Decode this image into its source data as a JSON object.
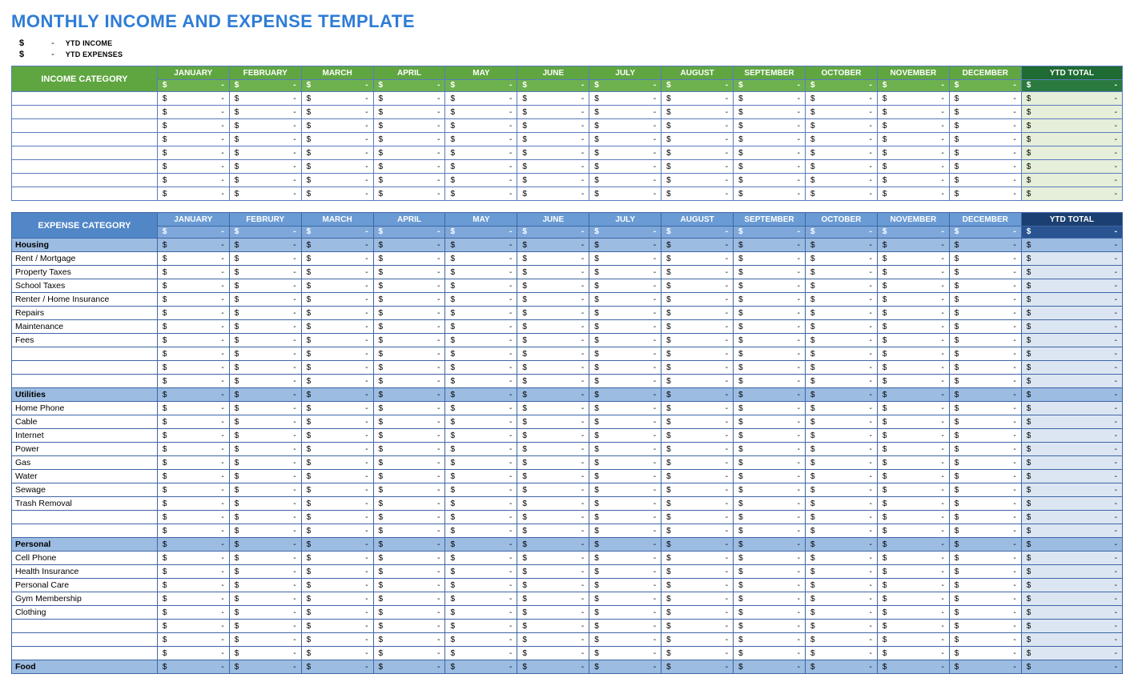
{
  "title": "MONTHLY INCOME AND EXPENSE TEMPLATE",
  "summary": {
    "ytd_income_symbol": "$",
    "ytd_income_dash": "-",
    "ytd_income_label": "YTD INCOME",
    "ytd_expenses_symbol": "$",
    "ytd_expenses_dash": "-",
    "ytd_expenses_label": "YTD EXPENSES"
  },
  "months_income": [
    "JANUARY",
    "FEBRUARY",
    "MARCH",
    "APRIL",
    "MAY",
    "JUNE",
    "JULY",
    "AUGUST",
    "SEPTEMBER",
    "OCTOBER",
    "NOVEMBER",
    "DECEMBER"
  ],
  "months_expense": [
    "JANUARY",
    "FEBRURY",
    "MARCH",
    "APRIL",
    "MAY",
    "JUNE",
    "JULY",
    "AUGUST",
    "SEPTEMBER",
    "OCTOBER",
    "NOVEMBER",
    "DECEMBER"
  ],
  "ytd_total_label": "YTD TOTAL",
  "income_category_label": "INCOME CATEGORY",
  "expense_category_label": "EXPENSE CATEGORY",
  "money_placeholder": {
    "symbol": "$",
    "value": "-"
  },
  "income_rows": [
    {
      "label": ""
    },
    {
      "label": ""
    },
    {
      "label": ""
    },
    {
      "label": ""
    },
    {
      "label": ""
    },
    {
      "label": ""
    },
    {
      "label": ""
    },
    {
      "label": ""
    }
  ],
  "expense_rows": [
    {
      "type": "section",
      "label": "Housing"
    },
    {
      "type": "item",
      "label": "Rent / Mortgage"
    },
    {
      "type": "item",
      "label": "Property Taxes"
    },
    {
      "type": "item",
      "label": "School Taxes"
    },
    {
      "type": "item",
      "label": "Renter / Home Insurance"
    },
    {
      "type": "item",
      "label": "Repairs"
    },
    {
      "type": "item",
      "label": "Maintenance"
    },
    {
      "type": "item",
      "label": "Fees"
    },
    {
      "type": "item",
      "label": ""
    },
    {
      "type": "item",
      "label": ""
    },
    {
      "type": "item",
      "label": ""
    },
    {
      "type": "section",
      "label": "Utilities"
    },
    {
      "type": "item",
      "label": "Home Phone"
    },
    {
      "type": "item",
      "label": "Cable"
    },
    {
      "type": "item",
      "label": "Internet"
    },
    {
      "type": "item",
      "label": "Power"
    },
    {
      "type": "item",
      "label": "Gas"
    },
    {
      "type": "item",
      "label": "Water"
    },
    {
      "type": "item",
      "label": "Sewage"
    },
    {
      "type": "item",
      "label": "Trash Removal"
    },
    {
      "type": "item",
      "label": ""
    },
    {
      "type": "item",
      "label": ""
    },
    {
      "type": "section",
      "label": "Personal"
    },
    {
      "type": "item",
      "label": "Cell Phone"
    },
    {
      "type": "item",
      "label": "Health Insurance"
    },
    {
      "type": "item",
      "label": "Personal Care"
    },
    {
      "type": "item",
      "label": "Gym Membership"
    },
    {
      "type": "item",
      "label": "Clothing"
    },
    {
      "type": "item",
      "label": ""
    },
    {
      "type": "item",
      "label": ""
    },
    {
      "type": "item",
      "label": ""
    },
    {
      "type": "section",
      "label": "Food"
    }
  ]
}
